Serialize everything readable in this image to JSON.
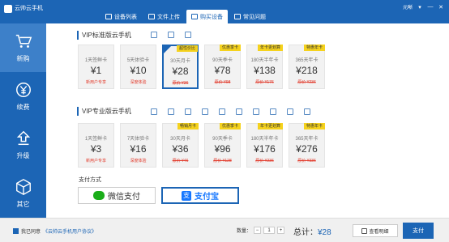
{
  "window": {
    "title": "云帅云手机",
    "user": "元晰",
    "controls": [
      "▾",
      "—",
      "✕"
    ]
  },
  "tabs": [
    {
      "label": "设备列表"
    },
    {
      "label": "文件上传"
    },
    {
      "label": "购买设备"
    },
    {
      "label": "常见问题"
    }
  ],
  "sidebar": [
    {
      "label": "新购"
    },
    {
      "label": "续费"
    },
    {
      "label": "升级"
    },
    {
      "label": "其它"
    }
  ],
  "standard": {
    "title": "VIP标准版云手机",
    "cards": [
      {
        "name": "1天签鲜卡",
        "price": "¥1",
        "note": "新用户专享",
        "old": "",
        "badge": ""
      },
      {
        "name": "5天体验卡",
        "price": "¥10",
        "note": "深度体验",
        "old": "",
        "badge": ""
      },
      {
        "name": "30天月卡",
        "price": "¥28",
        "note": "",
        "old": "原价 ¥36",
        "badge": "超性价比"
      },
      {
        "name": "90天季卡",
        "price": "¥78",
        "note": "",
        "old": "原价 ¥98",
        "badge": "优惠季卡"
      },
      {
        "name": "180天半年卡",
        "price": "¥138",
        "note": "",
        "old": "原价 ¥176",
        "badge": "年卡更划算"
      },
      {
        "name": "365天年卡",
        "price": "¥218",
        "note": "",
        "old": "原价 ¥236",
        "badge": "特惠年卡"
      }
    ]
  },
  "pro": {
    "title": "VIP专业版云手机",
    "cards": [
      {
        "name": "1天签鲜卡",
        "price": "¥3",
        "note": "新用户专享",
        "old": "",
        "badge": ""
      },
      {
        "name": "7天体验卡",
        "price": "¥16",
        "note": "深度体验",
        "old": "",
        "badge": ""
      },
      {
        "name": "30天月卡",
        "price": "¥36",
        "note": "",
        "old": "原价 ¥46",
        "badge": "畅销月卡"
      },
      {
        "name": "90天季卡",
        "price": "¥96",
        "note": "",
        "old": "原价 ¥128",
        "badge": "优惠季卡"
      },
      {
        "name": "180天半年卡",
        "price": "¥176",
        "note": "",
        "old": "原价 ¥236",
        "badge": "年卡更划算"
      },
      {
        "name": "365天年卡",
        "price": "¥276",
        "note": "",
        "old": "原价 ¥336",
        "badge": "特惠年卡"
      }
    ]
  },
  "payment": {
    "label": "支付方式",
    "wechat": "微信支付",
    "alipay": "支付宝",
    "alipay_glyph": "支"
  },
  "footer": {
    "agree_text": "我已同意",
    "agree_link": "《云帅云手机用户协议》",
    "qty_label": "数量：",
    "minus": "−",
    "qty": "1",
    "plus": "+",
    "total_label": "总计：",
    "total": "¥28",
    "detail": "查看明细",
    "pay": "支付"
  },
  "colors": {
    "accent": "#1c65b5",
    "badge": "#f5d21d",
    "wechat": "#1aad19",
    "alipay": "#1677ff"
  }
}
